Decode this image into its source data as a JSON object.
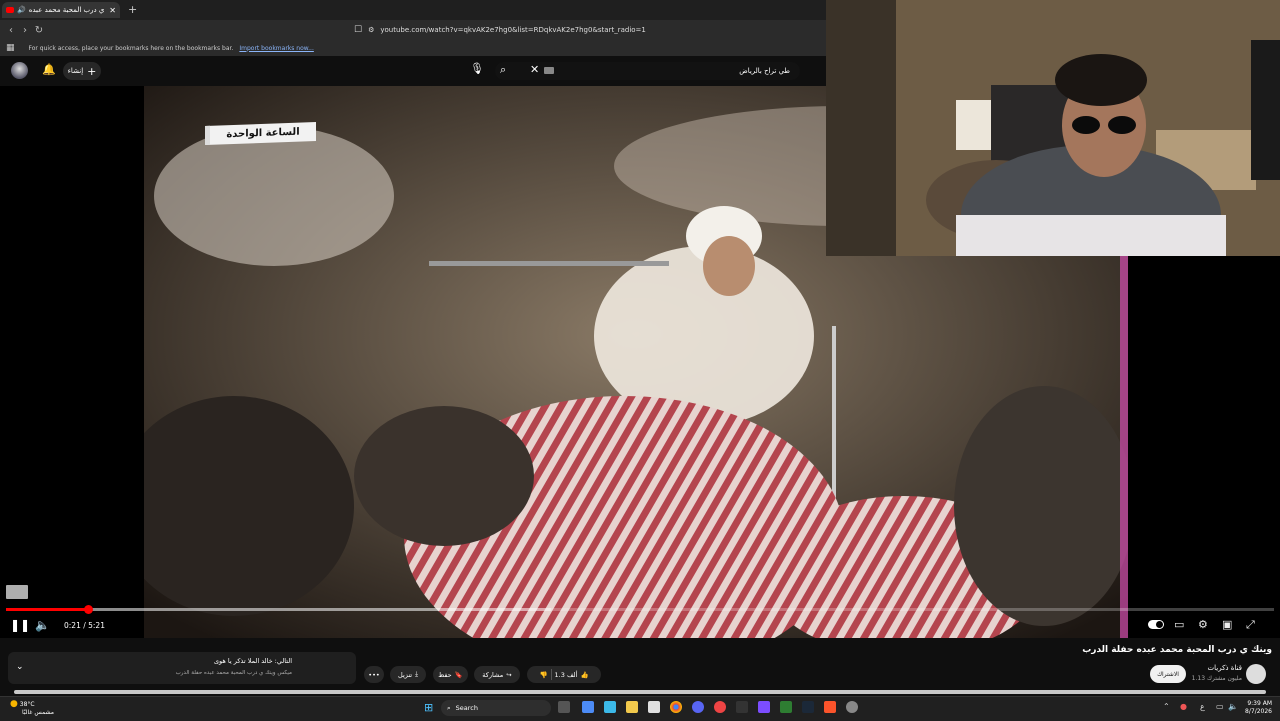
{
  "browser": {
    "tab_title": "وينك ي درب المحبة محمد عبده",
    "new_tab_label": "+",
    "url": "youtube.com/watch?v=qkvAK2e7hg0&list=RDqkvAK2e7hg0&start_radio=1",
    "bookmarks_prompt": "For quick access, place your bookmarks here on the bookmarks bar.",
    "bookmarks_link": "Import bookmarks now..."
  },
  "youtube": {
    "search_value": "طي تراح بالرياض",
    "create_label": "إنشاء"
  },
  "video": {
    "overlay_logo": "الساعة الواحدة",
    "current_time": "0:21",
    "duration": "5:21",
    "time_display": "0:21 / 5:21",
    "progress_fraction": 0.065,
    "buffered_fraction": 0.43,
    "title": "وينك ي درب المحبة محمد عبده حفلة الدرب",
    "channel_name": "قناة ذكريات",
    "subscribers": "1.13 مليون مشترك",
    "subscribe_label": "الاشتراك",
    "like_count": "1.3 ألف",
    "share_label": "مشاركة",
    "save_label": "حفظ",
    "download_label": "تنزيل",
    "more_label": "•••"
  },
  "playlist": {
    "next_label": "التالي: خالد الملا تذكر يا هوى",
    "subtitle": "ميكس وينك ي درب المحبة محمد عبده حفلة الدرب"
  },
  "taskbar": {
    "weather_temp": "38°C",
    "weather_desc": "مشمس غالبًا",
    "search_label": "Search",
    "time": "9:39 AM",
    "date": "8/7/2026",
    "lang": "ع"
  },
  "colors": {
    "accent_red": "#ff0000",
    "background": "#0f0f0f"
  }
}
